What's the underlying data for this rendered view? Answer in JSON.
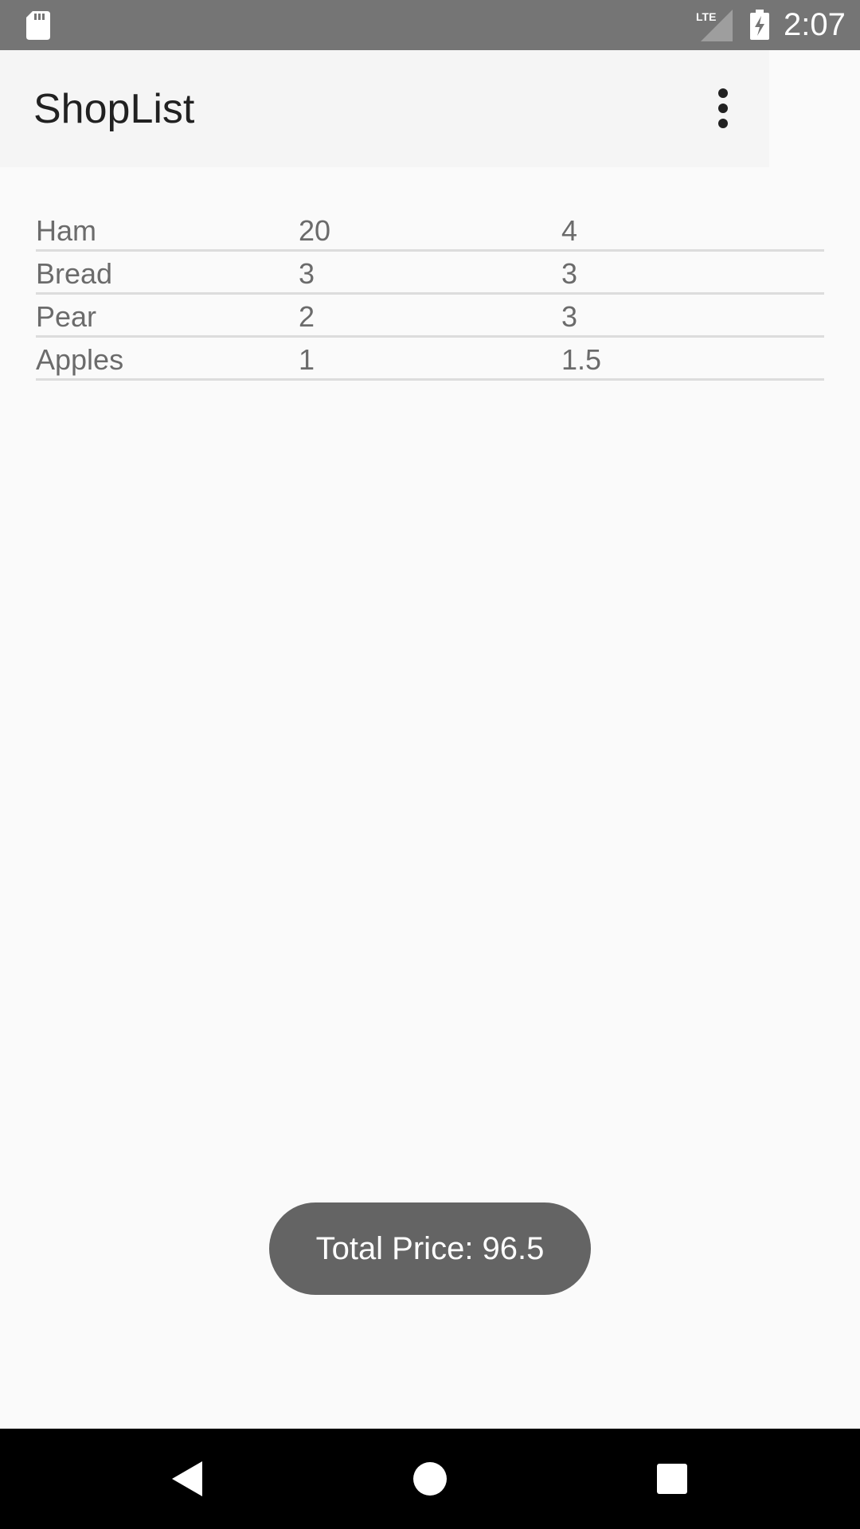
{
  "status_bar": {
    "time": "2:07",
    "network_label": "LTE",
    "icons": [
      "sd-card-icon",
      "lte-signal-icon",
      "battery-charging-icon"
    ]
  },
  "app_bar": {
    "title": "ShopList",
    "overflow_icon": "more-vert-icon"
  },
  "items": [
    {
      "name": "Ham",
      "quantity": "20",
      "price": "4"
    },
    {
      "name": "Bread",
      "quantity": "3",
      "price": "3"
    },
    {
      "name": "Pear",
      "quantity": "2",
      "price": "3"
    },
    {
      "name": "Apples",
      "quantity": "1",
      "price": "1.5"
    }
  ],
  "toast": {
    "text": "Total Price: 96.5"
  },
  "nav_bar": {
    "icons": [
      "back-icon",
      "home-icon",
      "recents-icon"
    ]
  },
  "colors": {
    "status_bar": "#757575",
    "app_bar": "#f5f5f5",
    "background": "#fafafa",
    "text_primary": "#212121",
    "text_secondary": "#6b6b6b",
    "divider": "#dcdcdc",
    "toast": "#646464",
    "nav_bar": "#000000"
  }
}
